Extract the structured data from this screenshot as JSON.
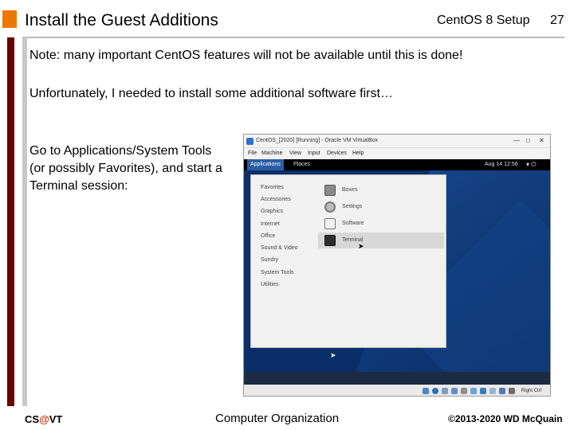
{
  "slide": {
    "title": "Install the Guest Additions",
    "course": "CentOS 8 Setup",
    "page_number": "27",
    "note": "Note:  many important CentOS features will not be available until this is done!",
    "unfortunately": "Unfortunately, I needed to install some additional software first…",
    "instruction": "Go to Applications/System Tools (or possibly Favorites), and start a Terminal session:"
  },
  "vm": {
    "window_title": "CentOS_[2020] [Running] - Oracle VM VirtualBox",
    "menu": [
      "File",
      "Machine",
      "View",
      "Input",
      "Devices",
      "Help"
    ],
    "gnome": {
      "applications": "Applications",
      "places": "Places",
      "clock": "Aug 14 12:56"
    },
    "categories": [
      "Favorites",
      "Accessories",
      "Graphics",
      "Internet",
      "Office",
      "Sound & Video",
      "Sundry",
      "System Tools",
      "Utilities"
    ],
    "apps": [
      {
        "label": "Boxes",
        "icon": "boxes-icon"
      },
      {
        "label": "Settings",
        "icon": "settings-icon"
      },
      {
        "label": "Software",
        "icon": "software-icon"
      },
      {
        "label": "Terminal",
        "icon": "terminal-icon",
        "selected": true
      }
    ],
    "status_right": "Right Ctrl"
  },
  "footer": {
    "left_a": "CS",
    "left_at": "@",
    "left_b": "VT",
    "middle": "Computer Organization",
    "right": "©2013-2020 WD McQuain"
  },
  "colors": {
    "accent_orange": "#ee7700",
    "maroon_bar": "#6b0000",
    "desktop_blue": "#0a2f68",
    "gnome_selected": "#2b5ca5"
  }
}
